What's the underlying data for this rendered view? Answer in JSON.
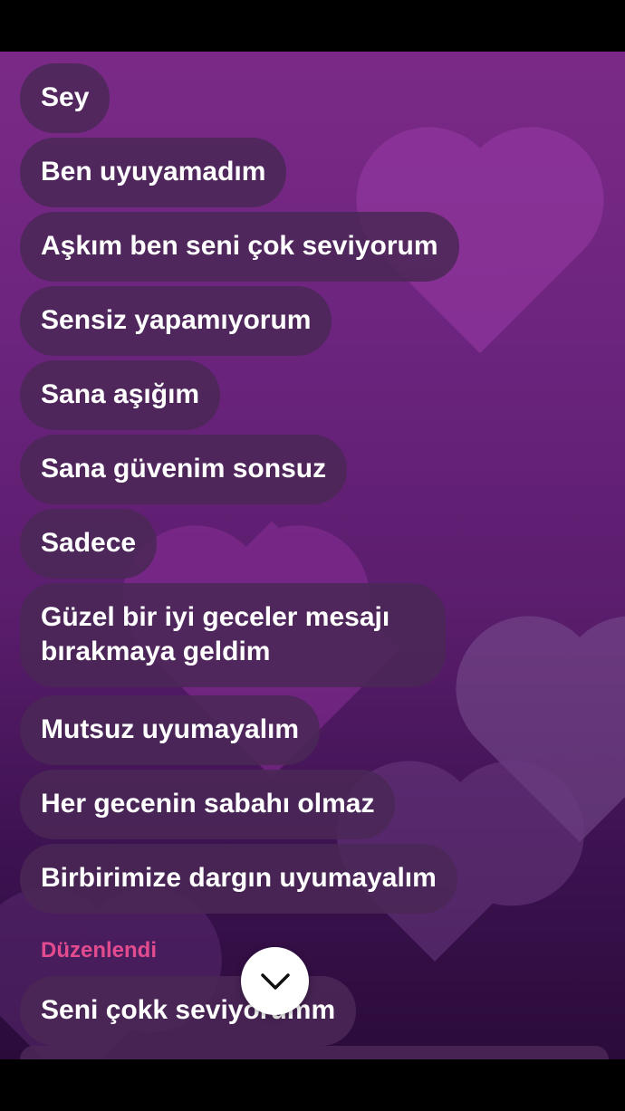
{
  "messages": [
    {
      "text": "Sey"
    },
    {
      "text": "Ben uyuyamadım"
    },
    {
      "text": "Aşkım ben seni çok seviyorum"
    },
    {
      "text": "Sensiz yapamıyorum"
    },
    {
      "text": "Sana aşığım"
    },
    {
      "text": "Sana güvenim sonsuz"
    },
    {
      "text": "Sadece"
    },
    {
      "text": "Güzel bir iyi geceler mesajı bırakmaya geldim"
    },
    {
      "text": "Mutsuz uyumayalım"
    },
    {
      "text": "Her gecenin sabahı olmaz"
    },
    {
      "text": "Birbirimize dargın uyumayalım"
    },
    {
      "text": "Seni çokk seviyorumm"
    }
  ],
  "edited_label": "Düzenlendi",
  "scroll_button": {
    "icon": "chevron-down-icon"
  },
  "colors": {
    "bubble": "#4a2856",
    "edited": "#e24c8e",
    "background_top": "#7a2a86",
    "background_bottom": "#2a0b3a"
  }
}
